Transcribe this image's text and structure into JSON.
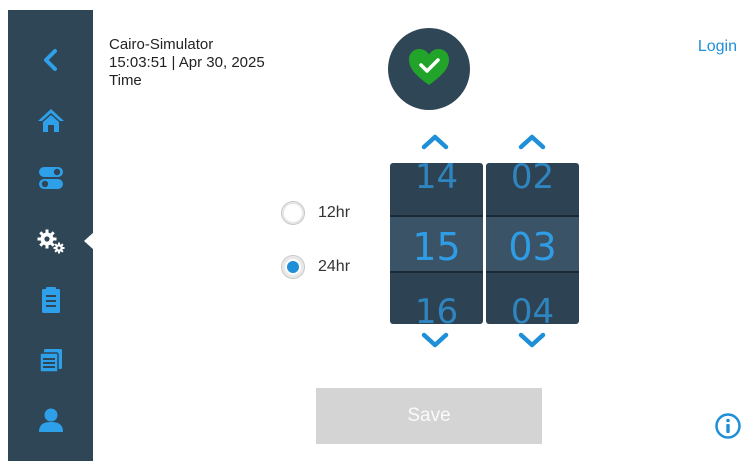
{
  "header": {
    "app_name": "Cairo-Simulator",
    "datetime": "15:03:51 | Apr 30, 2025",
    "page_title": "Time"
  },
  "login_label": "Login",
  "sidebar": {
    "items": [
      {
        "icon": "back-icon"
      },
      {
        "icon": "home-icon"
      },
      {
        "icon": "toggles-icon"
      },
      {
        "icon": "settings-gears-icon",
        "active": true
      },
      {
        "icon": "clipboard-icon"
      },
      {
        "icon": "files-icon"
      },
      {
        "icon": "user-icon"
      }
    ]
  },
  "status": {
    "icon": "heart-check-icon",
    "color": "#22a32a"
  },
  "time_format": {
    "options": [
      {
        "label": "12hr",
        "selected": false
      },
      {
        "label": "24hr",
        "selected": true
      }
    ]
  },
  "hour_picker": {
    "prev": "14",
    "current": "15",
    "next": "16"
  },
  "minute_picker": {
    "prev": "02",
    "current": "03",
    "next": "04"
  },
  "save_label": "Save",
  "colors": {
    "accent": "#1f8fd8",
    "sidebar": "#2f4656",
    "picker": "#2d4252"
  }
}
